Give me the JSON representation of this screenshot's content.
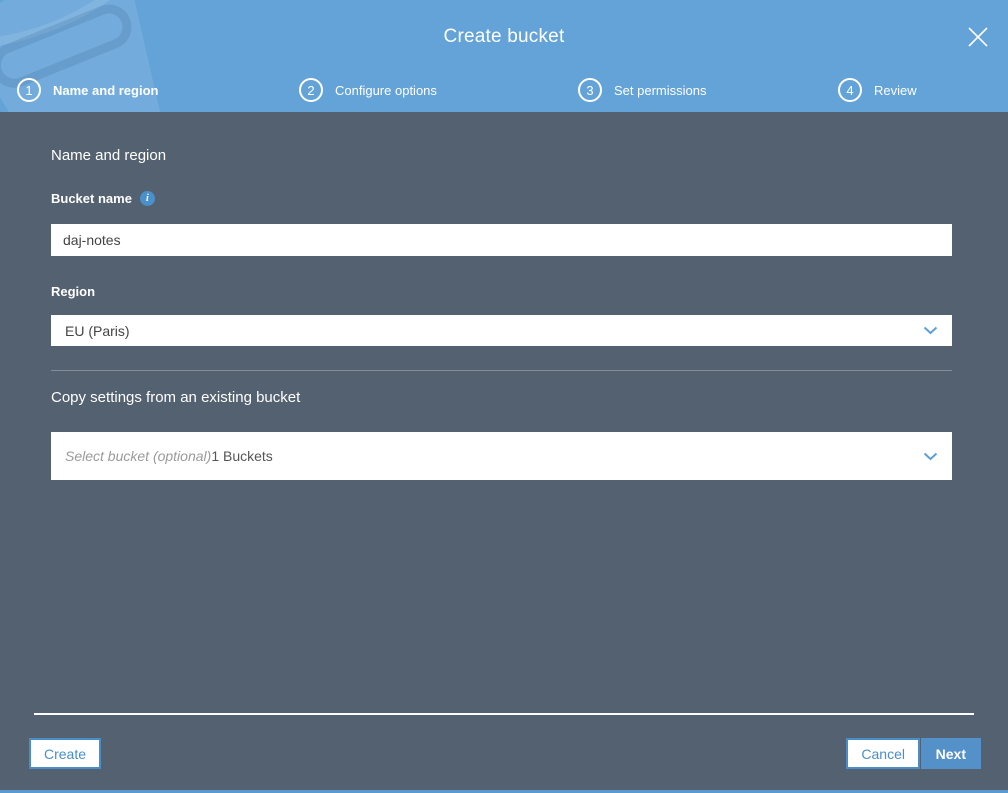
{
  "modal": {
    "title": "Create bucket"
  },
  "steps": [
    {
      "number": "1",
      "label": "Name and region",
      "active": true
    },
    {
      "number": "2",
      "label": "Configure options",
      "active": false
    },
    {
      "number": "3",
      "label": "Set permissions",
      "active": false
    },
    {
      "number": "4",
      "label": "Review",
      "active": false
    }
  ],
  "form": {
    "section_heading": "Name and region",
    "bucket_name": {
      "label": "Bucket name",
      "value": "daj-notes",
      "info_icon": "i"
    },
    "region": {
      "label": "Region",
      "value": "EU (Paris)"
    },
    "copy_settings": {
      "heading": "Copy settings from an existing bucket",
      "placeholder": "Select bucket (optional)",
      "suffix": "1 Buckets"
    }
  },
  "footer": {
    "create_label": "Create",
    "cancel_label": "Cancel",
    "next_label": "Next"
  },
  "colors": {
    "header_blue": "#64a3d8",
    "body_slate": "#536170",
    "accent_blue": "#4a8ec6",
    "next_button_blue": "#5591c9",
    "info_icon_blue": "#4a90c9"
  }
}
